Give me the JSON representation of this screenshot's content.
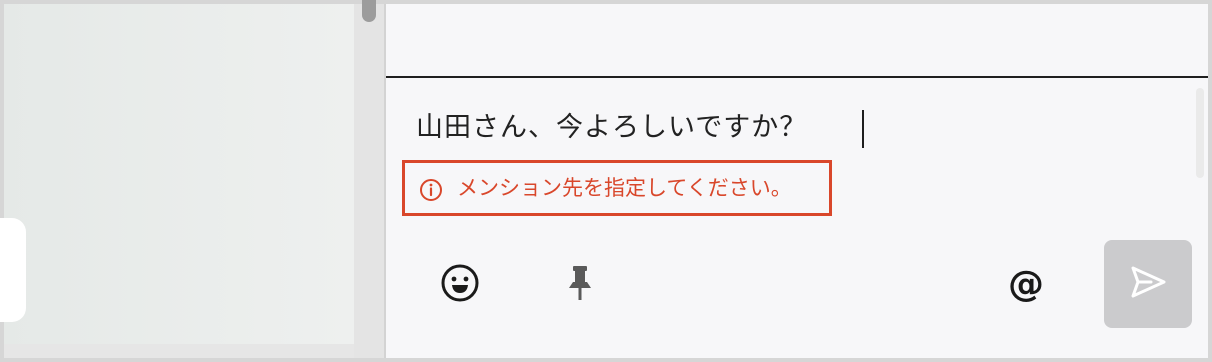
{
  "composer": {
    "message_text": "山田さん、今よろしいですか？",
    "error_message": "メンション先を指定してください。",
    "mention_symbol": "@"
  },
  "icons": {
    "error": "info-circle-icon",
    "emoji": "smiley-face-icon",
    "pin": "pushpin-icon",
    "mention": "at-sign-icon",
    "send": "paper-plane-icon"
  },
  "colors": {
    "error": "#d9472b",
    "send_disabled_bg": "#cbcbcd",
    "background": "#f7f7f9"
  }
}
